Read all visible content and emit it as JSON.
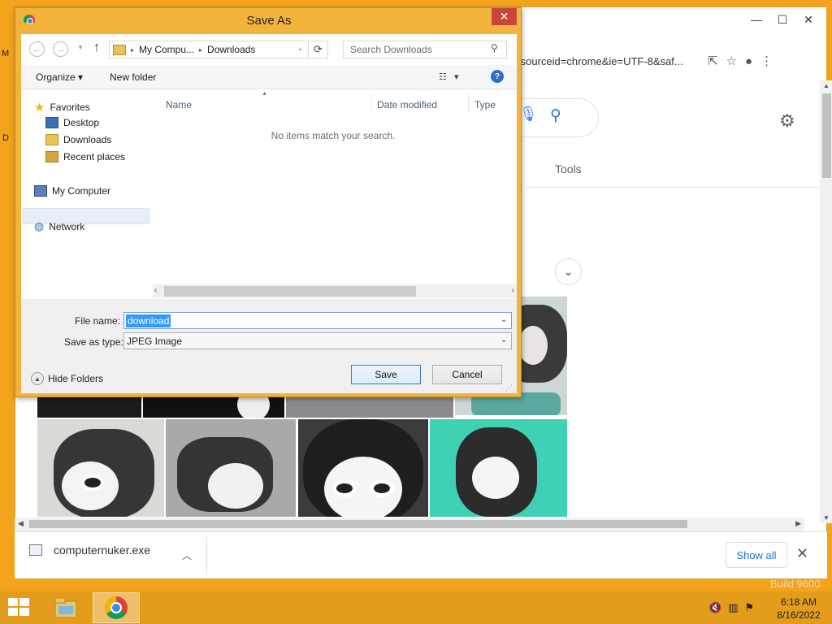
{
  "desktop": {
    "edge_letters": [
      "M",
      "D"
    ],
    "watermark": "Build 9600"
  },
  "chrome": {
    "window_controls": {
      "minimize": "—",
      "maximize": "☐",
      "close": "✕"
    },
    "address_url_fragment": "tsourceid=chrome&ie=UTF-8&saf...",
    "search_tools_label": "Tools",
    "download_bar": {
      "file_name": "computernuker.exe",
      "show_all_label": "Show all",
      "close_label": "✕"
    }
  },
  "dialog": {
    "title": "Save As",
    "close_label": "✕",
    "nav": {
      "back": "←",
      "forward": "→",
      "up": "↑"
    },
    "breadcrumb": {
      "part1": "My Compu...",
      "separator": "▸",
      "part2": "Downloads"
    },
    "search_placeholder": "Search Downloads",
    "toolbar": {
      "organize_label": "Organize ▾",
      "new_folder_label": "New folder",
      "help_label": "?"
    },
    "nav_pane": {
      "favorites": "Favorites",
      "desktop": "Desktop",
      "downloads": "Downloads",
      "recent_places": "Recent places",
      "my_computer": "My Computer",
      "network": "Network"
    },
    "columns": {
      "name": "Name",
      "date_modified": "Date modified",
      "type": "Type"
    },
    "empty_message": "No items match your search.",
    "file_name_label": "File name:",
    "file_name_value": "download",
    "save_as_type_label": "Save as type:",
    "save_as_type_value": "JPEG Image",
    "hide_folders_label": "Hide Folders",
    "save_label": "Save",
    "cancel_label": "Cancel"
  },
  "taskbar": {
    "time": "6:18 AM",
    "date": "8/16/2022"
  },
  "colors": {
    "desktop": "#f3a31c",
    "taskbar": "#e39c1b",
    "accent": "#3399ff",
    "close_red": "#c7463a"
  }
}
